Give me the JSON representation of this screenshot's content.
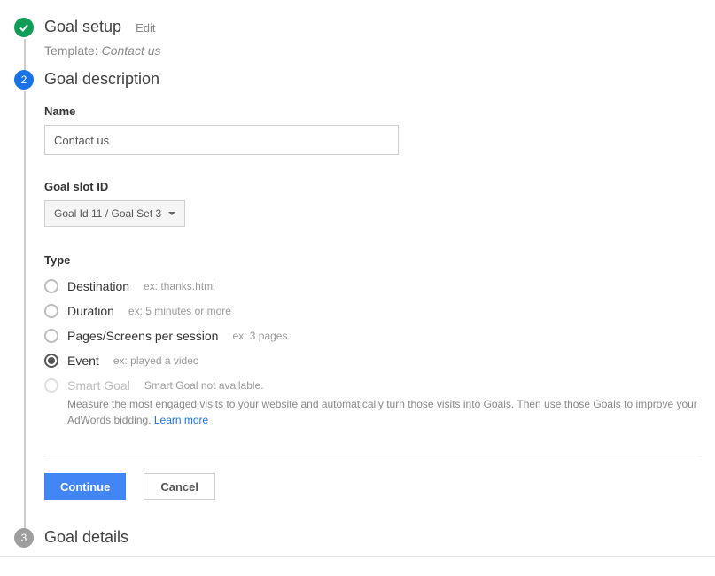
{
  "step1": {
    "title": "Goal setup",
    "edit_label": "Edit",
    "template_prefix": "Template:",
    "template_name": "Contact us"
  },
  "step2": {
    "number": "2",
    "title": "Goal description",
    "name_label": "Name",
    "name_value": "Contact us",
    "slot_label": "Goal slot ID",
    "slot_value": "Goal Id 11 / Goal Set 3",
    "type_label": "Type",
    "types": [
      {
        "label": "Destination",
        "hint": "ex: thanks.html"
      },
      {
        "label": "Duration",
        "hint": "ex: 5 minutes or more"
      },
      {
        "label": "Pages/Screens per session",
        "hint": "ex: 3 pages"
      },
      {
        "label": "Event",
        "hint": "ex: played a video"
      }
    ],
    "smart": {
      "label": "Smart Goal",
      "hint": "Smart Goal not available.",
      "desc": "Measure the most engaged visits to your website and automatically turn those visits into Goals. Then use those Goals to improve your AdWords bidding. ",
      "learn_more": "Learn more"
    },
    "continue_label": "Continue",
    "cancel_label": "Cancel"
  },
  "step3": {
    "number": "3",
    "title": "Goal details"
  }
}
